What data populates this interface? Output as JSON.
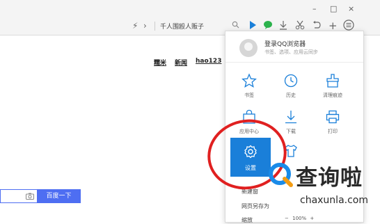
{
  "window": {
    "minimize": "–",
    "maximize": "□",
    "close": "×"
  },
  "toolbar": {
    "address_search_text": "千人围殴人贩子",
    "icons": [
      "lightning-icon",
      "chevron-right-icon",
      "search-icon",
      "play-icon",
      "chat-icon",
      "download-icon",
      "scissors-icon",
      "undo-icon",
      "plus-icon",
      "menu-icon"
    ]
  },
  "page_links": [
    "糯米",
    "新闻",
    "hao123"
  ],
  "search": {
    "button_label": "百度一下"
  },
  "menu": {
    "login": {
      "title": "登录QQ浏览器",
      "subtitle": "书签、选项、应用云同步"
    },
    "items": [
      {
        "label": "书签",
        "icon": "star-icon"
      },
      {
        "label": "历史",
        "icon": "clock-icon"
      },
      {
        "label": "清理痕迹",
        "icon": "broom-icon"
      },
      {
        "label": "应用中心",
        "icon": "bag-icon"
      },
      {
        "label": "下载",
        "icon": "download-icon"
      },
      {
        "label": "打印",
        "icon": "printer-icon"
      }
    ],
    "settings_label": "设置",
    "rows": [
      "新建窗",
      "网页另存为",
      "缩放"
    ],
    "zoom": {
      "minus": "−",
      "value": "100%",
      "plus": "+"
    }
  },
  "watermark": {
    "text": "查询啦",
    "url": "chaxunla.com"
  },
  "colors": {
    "accent": "#1a7fd9",
    "baidu_blue": "#4e6ef2",
    "annotation_red": "#e02020"
  }
}
